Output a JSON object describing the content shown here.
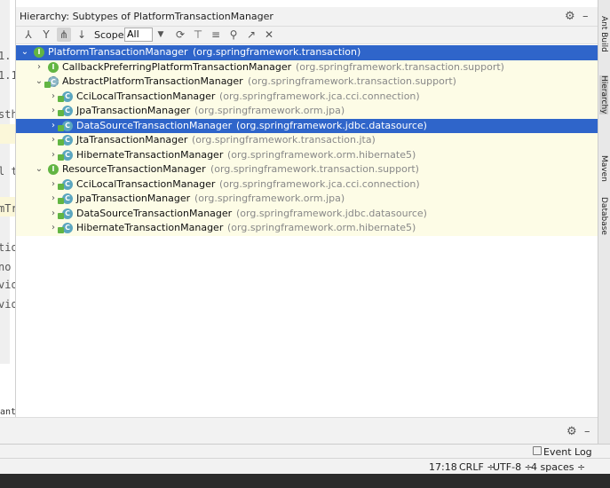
{
  "panel": {
    "title": "Hierarchy:  Subtypes of PlatformTransactionManager",
    "scope_label": "Scope:",
    "scope_value": "All"
  },
  "icons": {
    "settings": "gear-icon",
    "minimize": "minimize-icon",
    "expand_arrow": "▾",
    "collapse_arrow": "›"
  },
  "tree": [
    {
      "name": "PlatformTransactionManager",
      "pkg": "(org.springframework.transaction)",
      "icon": "interface",
      "selected": true,
      "level": 0
    },
    {
      "name": "CallbackPreferringPlatformTransactionManager",
      "pkg": "(org.springframework.transaction.support)",
      "icon": "interface",
      "level": 1
    },
    {
      "name": "AbstractPlatformTransactionManager",
      "pkg": "(org.springframework.transaction.support)",
      "icon": "abstract",
      "level": 1
    },
    {
      "name": "CciLocalTransactionManager",
      "pkg": "(org.springframework.jca.cci.connection)",
      "icon": "class",
      "level": 2
    },
    {
      "name": "JpaTransactionManager",
      "pkg": "(org.springframework.orm.jpa)",
      "icon": "class",
      "level": 2
    },
    {
      "name": "DataSourceTransactionManager",
      "pkg": "(org.springframework.jdbc.datasource)",
      "icon": "class",
      "selected": true,
      "level": 2
    },
    {
      "name": "JtaTransactionManager",
      "pkg": "(org.springframework.transaction.jta)",
      "icon": "class",
      "level": 2
    },
    {
      "name": "HibernateTransactionManager",
      "pkg": "(org.springframework.orm.hibernate5)",
      "icon": "class",
      "level": 2
    },
    {
      "name": "ResourceTransactionManager",
      "pkg": "(org.springframework.transaction.support)",
      "icon": "interface",
      "level": 1
    },
    {
      "name": "CciLocalTransactionManager",
      "pkg": "(org.springframework.jca.cci.connection)",
      "icon": "class",
      "level": 2
    },
    {
      "name": "JpaTransactionManager",
      "pkg": "(org.springframework.orm.jpa)",
      "icon": "class",
      "level": 2
    },
    {
      "name": "DataSourceTransactionManager",
      "pkg": "(org.springframework.jdbc.datasource)",
      "icon": "class",
      "level": 2
    },
    {
      "name": "HibernateTransactionManager",
      "pkg": "(org.springframework.orm.hibernate5)",
      "icon": "class",
      "level": 2
    }
  ],
  "right_tabs": [
    "Ant Build",
    "Hierarchy",
    "Maven",
    "Database"
  ],
  "editor_fragments": [
    "1.",
    "1.1",
    "sth",
    "l t",
    "mTr",
    "tio",
    "no",
    "vio",
    "vio",
    "ant()"
  ],
  "event_log": "Event Log",
  "status": {
    "position": "17:18",
    "line_sep": "CRLF ÷",
    "encoding": "UTF-8 ÷",
    "indent": "4 spaces ÷"
  },
  "colors": {
    "selection": "#2f65ca",
    "tree_bg": "#fdfce6",
    "class_icon": "#5ba6bf",
    "interface_icon": "#62b543"
  }
}
